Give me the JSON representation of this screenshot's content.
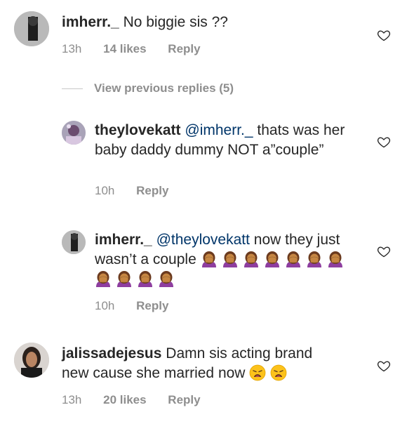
{
  "comments": [
    {
      "username": "imherr._",
      "text": "No biggie sis ??",
      "time": "13h",
      "likes": "14 likes",
      "reply": "Reply"
    },
    {
      "username": "theylovekatt",
      "mention": "@imherr._",
      "text": "thats was her baby daddy dummy NOT a”couple”",
      "time": "10h",
      "reply": "Reply"
    },
    {
      "username": "imherr._",
      "mention": "@theylovekatt",
      "text": "now they just wasn’t a couple",
      "emojis": [
        "person-facepalming-emoji",
        "person-facepalming-emoji",
        "person-facepalming-emoji",
        "person-facepalming-emoji",
        "person-facepalming-emoji",
        "person-facepalming-emoji",
        "person-facepalming-emoji",
        "person-facepalming-emoji",
        "person-facepalming-emoji",
        "person-facepalming-emoji",
        "person-facepalming-emoji"
      ],
      "time": "10h",
      "reply": "Reply"
    },
    {
      "username": "jalissadejesus",
      "text": "Damn sis acting brand new cause she married now",
      "emojis": [
        "weary-face-emoji",
        "weary-face-emoji"
      ],
      "time": "13h",
      "likes": "20 likes",
      "reply": "Reply"
    }
  ],
  "view_previous": "View previous replies (5)",
  "icons": {
    "like": "heart-outline-icon"
  },
  "colors": {
    "text": "#262626",
    "secondary": "#8e8e8e",
    "mention": "#003569",
    "skin": "#c68642",
    "shirt": "#8e3e9f"
  }
}
